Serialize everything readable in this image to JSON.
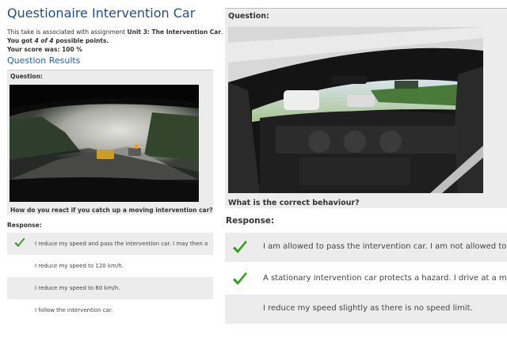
{
  "page": {
    "title": "Questionaire Intervention Car",
    "assignment_prefix": "This take is associated with assignment ",
    "assignment_name": "Unit 3: The Intervention Car",
    "assignment_suffix": ".",
    "points_prefix": "You got ",
    "points_value": "4 of 4",
    "points_suffix": " possible points.",
    "score_label": "Your score was: 100 %",
    "results_link": "Question Results"
  },
  "left_question": {
    "label": "Question:",
    "text": "How do you react if you catch up a moving intervention car?",
    "image_icon": "photo-onboard-camera-foggy-road",
    "response_label": "Response:",
    "answers": [
      {
        "text": "I reduce my speed and pass the intervention car. I may then o",
        "checked": true,
        "shaded": true
      },
      {
        "text": "I reduce my speed to 120 km/h.",
        "checked": false,
        "shaded": false
      },
      {
        "text": "I reduce my speed to 60 km/h.",
        "checked": false,
        "shaded": true
      },
      {
        "text": "I follow the intervention car.",
        "checked": false,
        "shaded": false
      }
    ]
  },
  "right_question": {
    "label": "Question:",
    "text": "What is the correct behaviour?",
    "image_icon": "photo-racecar-cockpit",
    "response_label": "Response:",
    "answers": [
      {
        "text": "I am allowed to pass the intervention car. I am not allowed to o",
        "checked": true,
        "shaded": true
      },
      {
        "text": "A stationary intervention car protects a hazard. I drive at a max",
        "checked": true,
        "shaded": false
      },
      {
        "text": "I reduce my speed slightly as there is no speed limit.",
        "checked": false,
        "shaded": true
      }
    ]
  },
  "colors": {
    "title": "#1f4e8c",
    "link": "#1f5faa",
    "check": "#2e9e1f",
    "panel": "#ececec"
  }
}
